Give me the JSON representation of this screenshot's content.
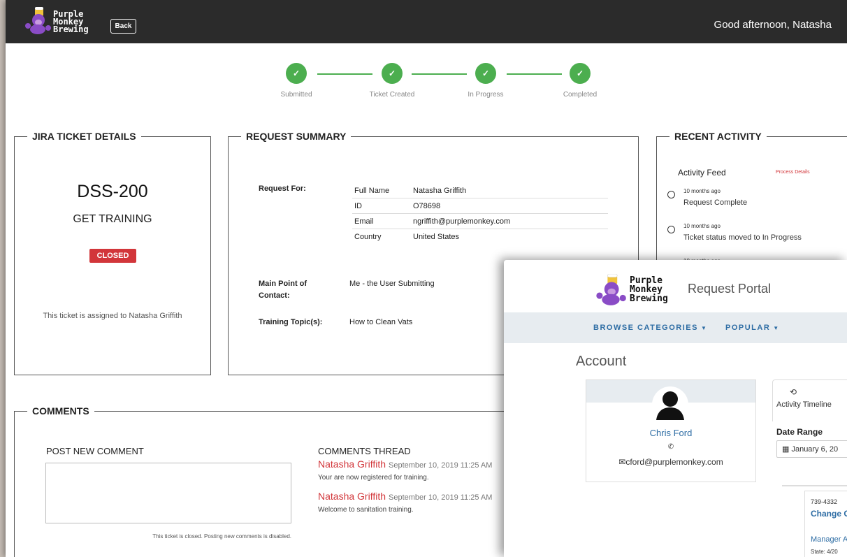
{
  "header": {
    "logo_text": [
      "Purple",
      "Monkey",
      "Brewing"
    ],
    "back_label": "Back",
    "greeting_prefix": "Good afternoon, ",
    "greeting_name": "Natasha"
  },
  "progress": {
    "steps": [
      {
        "label": "Submitted",
        "complete": true
      },
      {
        "label": "Ticket Created",
        "complete": true
      },
      {
        "label": "In Progress",
        "complete": true
      },
      {
        "label": "Completed",
        "complete": true
      }
    ],
    "accent_color": "#4cae4f"
  },
  "jira": {
    "section_title": "JIRA TICKET DETAILS",
    "ticket_id": "DSS-200",
    "ticket_title": "GET TRAINING",
    "status": "CLOSED",
    "status_color": "#d2363a",
    "assigned_text": "This ticket is assigned to Natasha Griffith"
  },
  "summary": {
    "section_title": "REQUEST SUMMARY",
    "request_for_label": "Request For:",
    "rows": [
      {
        "key": "Full Name",
        "value": "Natasha Griffith"
      },
      {
        "key": "ID",
        "value": "O78698"
      },
      {
        "key": "Email",
        "value": "ngriffith@purplemonkey.com"
      },
      {
        "key": "Country",
        "value": "United States"
      }
    ],
    "contact_label": "Main Point of Contact:",
    "contact_value": "Me - the User Submitting",
    "topic_label": "Training Topic(s):",
    "topic_value": "How to Clean Vats"
  },
  "activity": {
    "section_title": "RECENT ACTIVITY",
    "feed_title": "Activity Feed",
    "process_link": "Process Details",
    "items": [
      {
        "time": "10 months ago",
        "desc": "Request Complete"
      },
      {
        "time": "10 months ago",
        "desc": "Ticket status moved to In Progress"
      },
      {
        "time": "10 months ago",
        "desc": ""
      }
    ]
  },
  "comments": {
    "section_title": "COMMENTS",
    "post_heading": "POST NEW COMMENT",
    "closed_note": "This ticket is closed. Posting new comments is disabled.",
    "thread_heading": "COMMENTS THREAD",
    "thread": [
      {
        "author": "Natasha Griffith",
        "date": "September 10, 2019 11:25 AM",
        "text": "Your are now registered for training."
      },
      {
        "author": "Natasha Griffith",
        "date": "September 10, 2019 11:25 AM",
        "text": "Welcome to sanitation training."
      }
    ]
  },
  "portal": {
    "logo_text": [
      "Purple",
      "Monkey",
      "Brewing"
    ],
    "title": "Request Portal",
    "nav": [
      "BROWSE CATEGORIES",
      "POPULAR"
    ],
    "account_title": "Account",
    "profile": {
      "name": "Chris Ford",
      "email": "cford@purplemonkey.com"
    },
    "tab_label": "Activity Timeline",
    "date_range_label": "Date Range",
    "date_range_value": "January 6, 20",
    "card": {
      "number": "739-4332",
      "title": "Change C",
      "manager": "Manager A",
      "state": "State: 4/20"
    }
  }
}
